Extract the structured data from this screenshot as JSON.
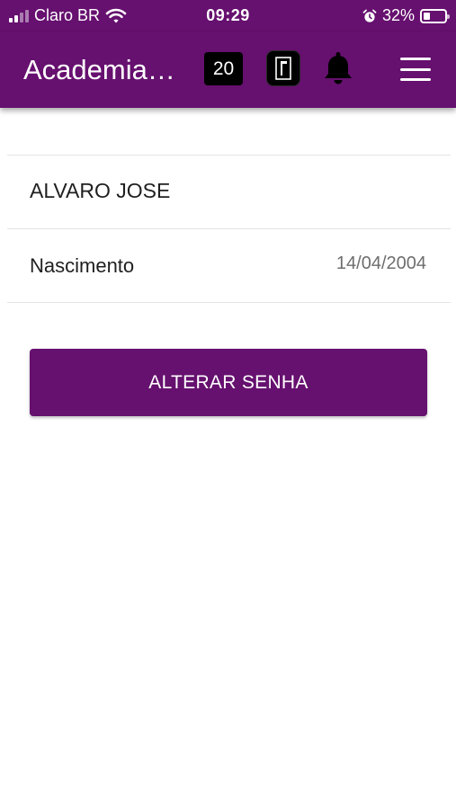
{
  "status_bar": {
    "carrier": "Claro BR",
    "time": "09:29",
    "battery_percent": "32%",
    "battery_level": 0.32,
    "icons": [
      "signal-icon",
      "wifi-icon",
      "alarm-icon",
      "battery-icon"
    ]
  },
  "app_bar": {
    "title": "Academia…",
    "badge_count": "20",
    "icons": [
      "door-icon",
      "bell-icon",
      "menu-icon"
    ]
  },
  "profile": {
    "name": "ALVARO JOSE",
    "birth_label": "Nascimento",
    "birth_value": "14/04/2004"
  },
  "actions": {
    "change_password_label": "ALTERAR SENHA"
  },
  "colors": {
    "primary": "#66106f",
    "background": "#ffffff",
    "divider": "#e3e3e3",
    "muted_text": "#6e6e6e"
  }
}
